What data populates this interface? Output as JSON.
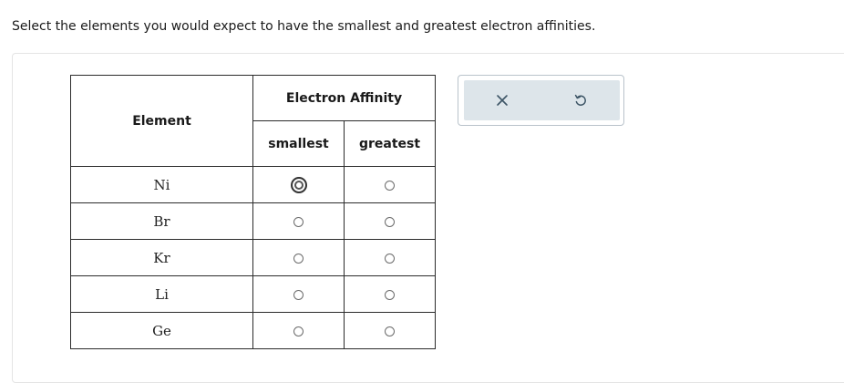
{
  "question": {
    "text": "Select the elements you would expect to have the smallest and greatest electron affinities."
  },
  "table": {
    "element_header": "Element",
    "group_header": "Electron Affinity",
    "col_smallest": "smallest",
    "col_greatest": "greatest",
    "rows": [
      {
        "element": "Ni",
        "smallest_selected": false,
        "greatest_selected": false
      },
      {
        "element": "Br",
        "smallest_selected": false,
        "greatest_selected": false
      },
      {
        "element": "Kr",
        "smallest_selected": false,
        "greatest_selected": false
      },
      {
        "element": "Li",
        "smallest_selected": false,
        "greatest_selected": false
      },
      {
        "element": "Ge",
        "smallest_selected": false,
        "greatest_selected": false
      }
    ]
  },
  "toolbox": {
    "clear_icon": "close-icon",
    "undo_icon": "undo-icon"
  },
  "colors": {
    "toolbox_bg": "#dde5ea",
    "toolbox_border": "#b9c3cb",
    "icon_color": "#3d5566"
  }
}
